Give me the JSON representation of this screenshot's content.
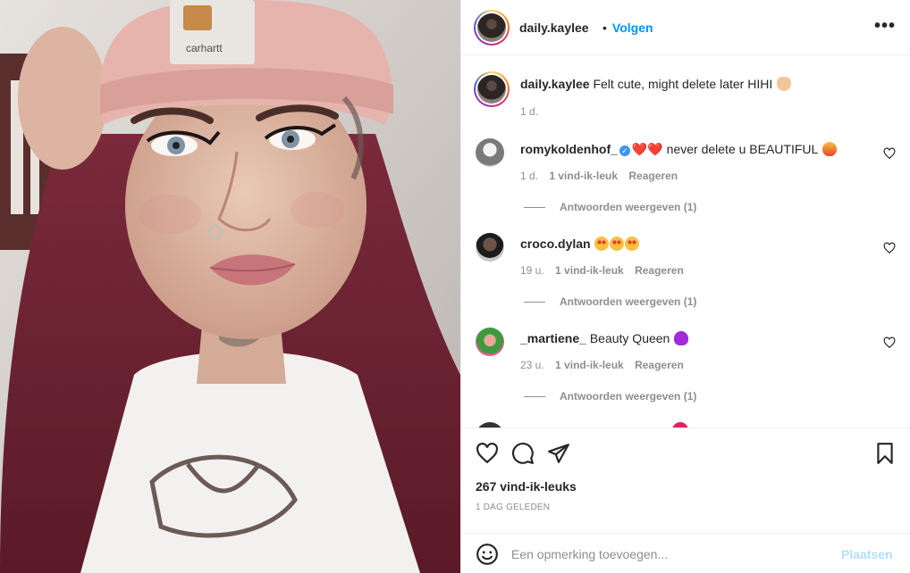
{
  "photo": {
    "beanie_label": "carhartt"
  },
  "header": {
    "username": "daily.kaylee",
    "separator": "•",
    "follow_label": "Volgen",
    "more_label": "•••"
  },
  "caption": {
    "username": "daily.kaylee",
    "text": "Felt cute, might delete later HIHI",
    "emoji_icon": "waving-hand-icon",
    "time": "1 d."
  },
  "comments": [
    {
      "username": "romykoldenhof_",
      "verified": true,
      "hearts": "❤️❤️",
      "text": "never delete u BEAUTIFUL",
      "emoji_icon": "fire-icon",
      "time": "1 d.",
      "likes": "1 vind-ik-leuk",
      "reply_label": "Reageren",
      "view_replies": "Antwoorden weergeven (1)"
    },
    {
      "username": "croco.dylan",
      "text": "",
      "emoji_icon": "heart-eyes-icon",
      "time": "19 u.",
      "likes": "1 vind-ik-leuk",
      "reply_label": "Reageren",
      "view_replies": "Antwoorden weergeven (1)"
    },
    {
      "username": "_martiene_",
      "text": "Beauty Queen",
      "emoji_icon": "purple-heart-icon",
      "time": "23 u.",
      "likes": "1 vind-ik-leuk",
      "reply_label": "Reageren",
      "view_replies": "Antwoorden weergeven (1)"
    }
  ],
  "footer": {
    "likes": "267 vind-ik-leuks",
    "time_ago": "1 DAG GELEDEN"
  },
  "comment_box": {
    "placeholder": "Een opmerking toevoegen...",
    "post_label": "Plaatsen"
  },
  "colors": {
    "accent": "#0095f6",
    "post_disabled": "#b2dffc",
    "muted": "#8e8e8e",
    "text": "#262626",
    "border": "#efefef"
  }
}
